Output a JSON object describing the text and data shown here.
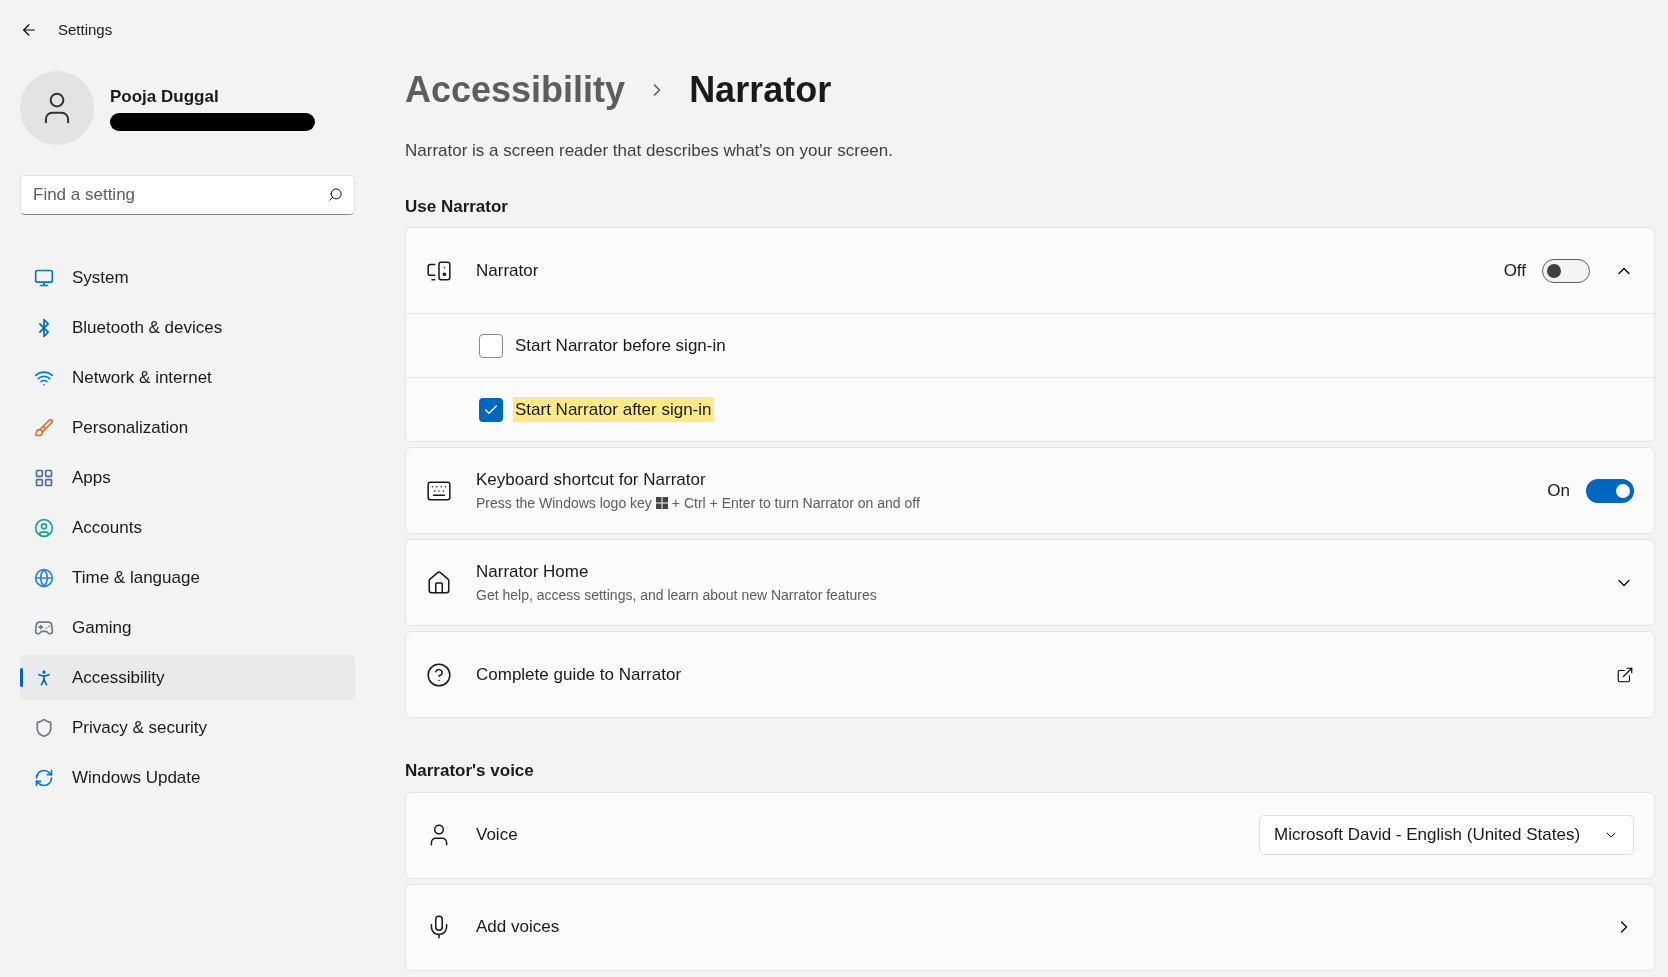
{
  "window": {
    "title": "Settings"
  },
  "user": {
    "name": "Pooja Duggal"
  },
  "search": {
    "placeholder": "Find a setting"
  },
  "sidebar": {
    "items": [
      {
        "label": "System",
        "kind": "system",
        "selected": false
      },
      {
        "label": "Bluetooth & devices",
        "kind": "bluetooth",
        "selected": false
      },
      {
        "label": "Network & internet",
        "kind": "network",
        "selected": false
      },
      {
        "label": "Personalization",
        "kind": "personalization",
        "selected": false
      },
      {
        "label": "Apps",
        "kind": "apps",
        "selected": false
      },
      {
        "label": "Accounts",
        "kind": "accounts",
        "selected": false
      },
      {
        "label": "Time & language",
        "kind": "time",
        "selected": false
      },
      {
        "label": "Gaming",
        "kind": "gaming",
        "selected": false
      },
      {
        "label": "Accessibility",
        "kind": "accessibility",
        "selected": true
      },
      {
        "label": "Privacy & security",
        "kind": "privacy",
        "selected": false
      },
      {
        "label": "Windows Update",
        "kind": "update",
        "selected": false
      }
    ]
  },
  "breadcrumb": [
    {
      "label": "Accessibility"
    },
    {
      "label": "Narrator"
    }
  ],
  "description": "Narrator is a screen reader that describes what's on your screen.",
  "sections": [
    {
      "heading": "Use Narrator",
      "cards": [
        {
          "kind": "toggle",
          "title": "Narrator",
          "state_label": "Off",
          "on": false,
          "expanded": true,
          "options": [
            {
              "label": "Start Narrator before sign-in",
              "checked": false,
              "highlighted": false
            },
            {
              "label": "Start Narrator after sign-in",
              "checked": true,
              "highlighted": true
            }
          ]
        },
        {
          "kind": "toggle",
          "title": "Keyboard shortcut for Narrator",
          "subtitle_before": "Press the Windows logo key",
          "subtitle_after": "+ Ctrl + Enter to turn Narrator on and off",
          "state_label": "On",
          "on": true
        },
        {
          "kind": "expander",
          "title": "Narrator Home",
          "subtitle": "Get help, access settings, and learn about new Narrator features",
          "expanded": false
        },
        {
          "kind": "link",
          "title": "Complete guide to Narrator"
        }
      ]
    },
    {
      "heading": "Narrator's voice",
      "cards": [
        {
          "kind": "dropdown",
          "title": "Voice",
          "value": "Microsoft David - English (United States)"
        },
        {
          "kind": "nav",
          "title": "Add voices"
        }
      ]
    }
  ]
}
